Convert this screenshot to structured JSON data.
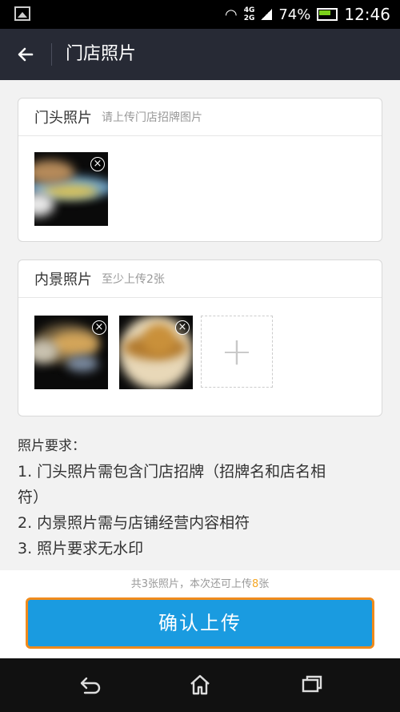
{
  "status_bar": {
    "network": "4G\n2G",
    "battery": "74%",
    "time": "12:46"
  },
  "header": {
    "back_icon": "arrow-left-icon",
    "title": "门店照片"
  },
  "storefront": {
    "title": "门头照片",
    "hint": "请上传门店招牌图片"
  },
  "interior": {
    "title": "内景照片",
    "hint": "至少上传2张",
    "add_label": "+"
  },
  "requirements": {
    "title": "照片要求：",
    "items": [
      "1. 门头照片需包含门店招牌（招牌名和店名相",
      "符）",
      "2. 内景照片需与店铺经营内容相符",
      "3. 照片要求无水印"
    ]
  },
  "footer": {
    "count_prefix": "共3张照片，本次还可上传",
    "count_number": "8",
    "count_suffix": "张",
    "confirm_label": "确认上传"
  },
  "nav": {
    "back_icon": "back-icon",
    "home_icon": "home-icon",
    "recent_icon": "recent-apps-icon"
  },
  "colors": {
    "header_bg": "#272a35",
    "button_bg": "#1a9be0",
    "button_border": "#f08b1c",
    "highlight": "#f5a623"
  }
}
